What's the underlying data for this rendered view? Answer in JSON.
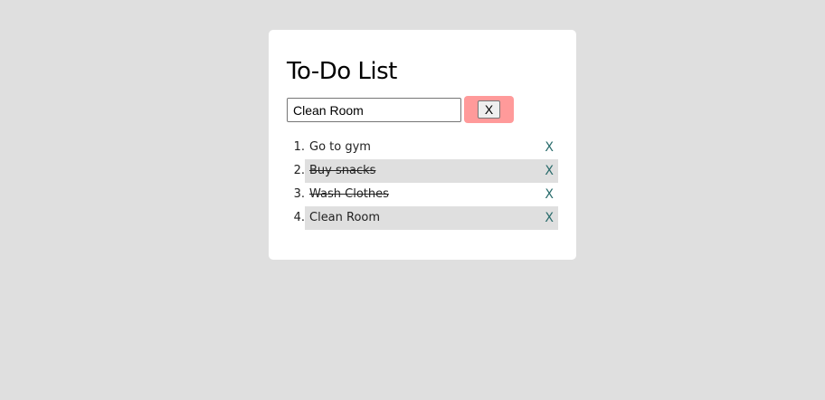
{
  "app": {
    "title": "To-Do List"
  },
  "input": {
    "value": "Clean Room",
    "placeholder": ""
  },
  "add_button": {
    "label": "X"
  },
  "tasks": [
    {
      "number": "1.",
      "text": "Go to gym",
      "completed": false,
      "delete_label": "X"
    },
    {
      "number": "2.",
      "text": "Buy snacks",
      "completed": true,
      "delete_label": "X"
    },
    {
      "number": "3.",
      "text": "Wash Clothes",
      "completed": true,
      "delete_label": "X"
    },
    {
      "number": "4.",
      "text": "Clean Room",
      "completed": false,
      "delete_label": "X"
    }
  ],
  "colors": {
    "background": "#dfdfdf",
    "card": "#ffffff",
    "button_highlight": "#ff9a9a",
    "delete_icon": "#2a6c6c",
    "row_shade": "#dfdfdf"
  }
}
